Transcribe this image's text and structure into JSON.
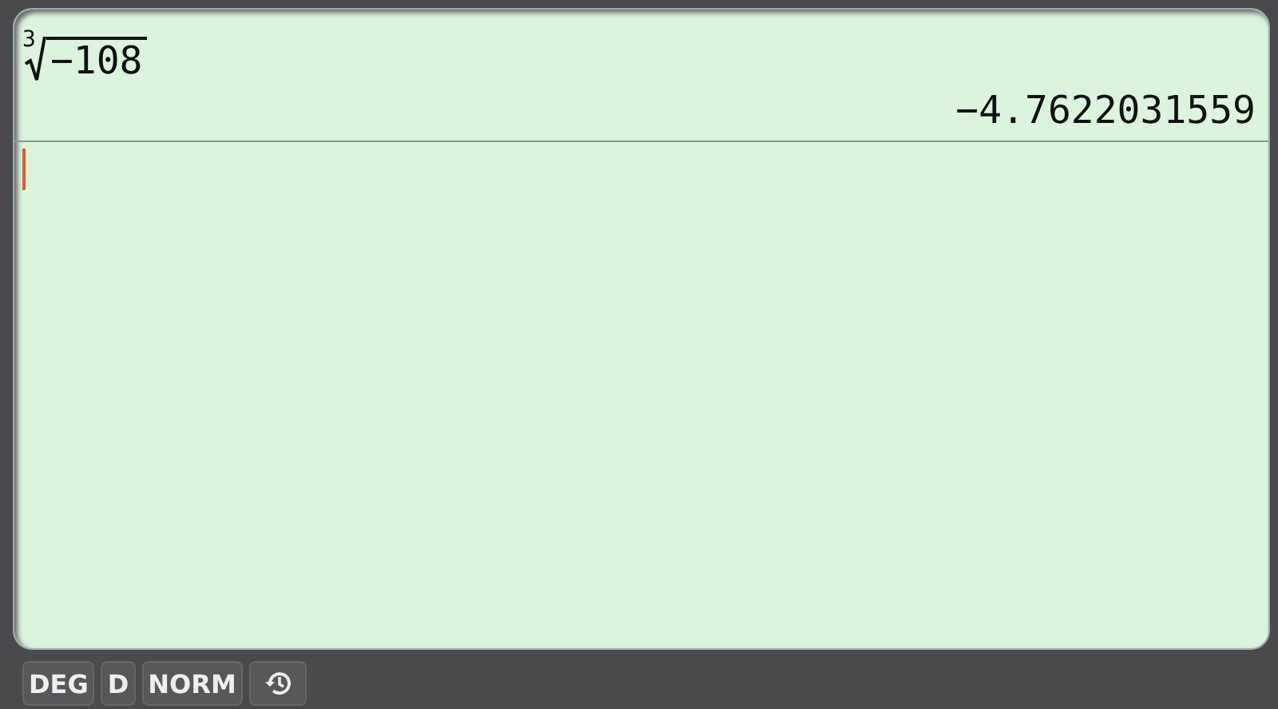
{
  "display": {
    "expression": {
      "kind": "root",
      "index": "3",
      "radicand": "−108"
    },
    "result": "−4.7622031559"
  },
  "status_bar": [
    {
      "kind": "text",
      "label": "DEG"
    },
    {
      "kind": "text",
      "label": "D"
    },
    {
      "kind": "text",
      "label": "NORM"
    },
    {
      "kind": "history"
    }
  ]
}
